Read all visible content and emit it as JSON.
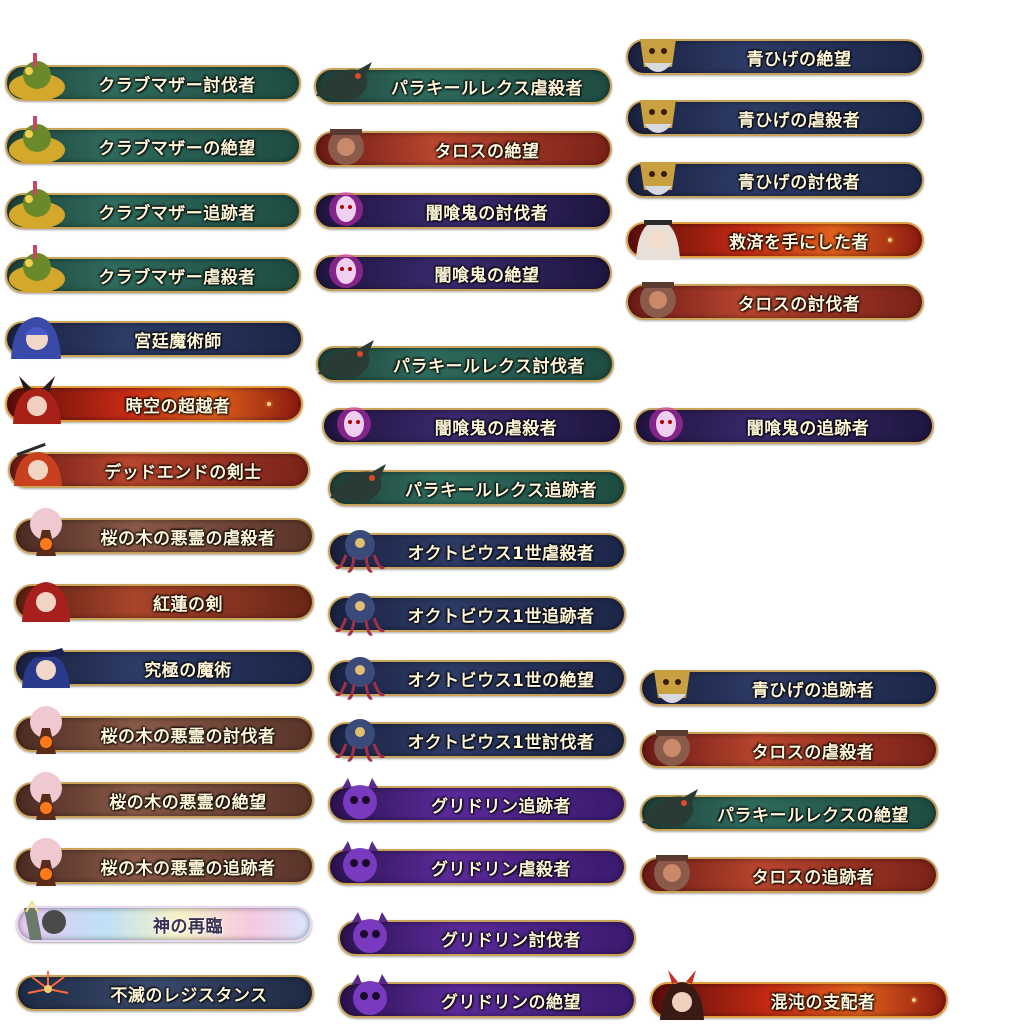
{
  "colors": {
    "gold_border": "#c9a35a",
    "label_text": "#fff6d8"
  },
  "badges": [
    {
      "label": "クラブマザー討伐者",
      "icon": "crab-monster-icon",
      "theme": "green"
    },
    {
      "label": "クラブマザーの絶望",
      "icon": "crab-monster-icon",
      "theme": "green"
    },
    {
      "label": "クラブマザー追跡者",
      "icon": "crab-monster-icon",
      "theme": "green"
    },
    {
      "label": "クラブマザー虐殺者",
      "icon": "crab-monster-icon",
      "theme": "green"
    },
    {
      "label": "宮廷魔術師",
      "icon": "blue-haired-mage-icon",
      "theme": "navy"
    },
    {
      "label": "時空の超越者",
      "icon": "horned-red-hair-portrait-icon",
      "theme": "fire"
    },
    {
      "label": "デッドエンドの剣士",
      "icon": "red-hair-swordsman-icon",
      "theme": "red"
    },
    {
      "label": "桜の木の悪霊の虐殺者",
      "icon": "cherry-tree-spirit-icon",
      "theme": "brown"
    },
    {
      "label": "紅蓮の剣",
      "icon": "crimson-hair-portrait-icon",
      "theme": "rust"
    },
    {
      "label": "究極の魔術",
      "icon": "blue-witch-icon",
      "theme": "navy"
    },
    {
      "label": "桜の木の悪霊の討伐者",
      "icon": "cherry-tree-spirit-icon",
      "theme": "brown"
    },
    {
      "label": "桜の木の悪霊の絶望",
      "icon": "cherry-tree-spirit-icon",
      "theme": "brown"
    },
    {
      "label": "桜の木の悪霊の追跡者",
      "icon": "cherry-tree-spirit-icon",
      "theme": "brown"
    },
    {
      "label": "神の再臨",
      "icon": "divine-crest-icon",
      "theme": "holo"
    },
    {
      "label": "不滅のレジスタンス",
      "icon": "firework-icon",
      "theme": "bluegray"
    },
    {
      "label": "パラキールレクス虐殺者",
      "icon": "dragon-icon",
      "theme": "green"
    },
    {
      "label": "タロスの絶望",
      "icon": "talos-golem-icon",
      "theme": "red"
    },
    {
      "label": "闇喰鬼の討伐者",
      "icon": "dark-demon-icon",
      "theme": "purple"
    },
    {
      "label": "闇喰鬼の絶望",
      "icon": "dark-demon-icon",
      "theme": "purple"
    },
    {
      "label": "パラキールレクス討伐者",
      "icon": "dragon-icon",
      "theme": "green"
    },
    {
      "label": "闇喰鬼の虐殺者",
      "icon": "dark-demon-icon",
      "theme": "purple"
    },
    {
      "label": "パラキールレクス追跡者",
      "icon": "dragon-icon",
      "theme": "green"
    },
    {
      "label": "オクトビウス1世虐殺者",
      "icon": "octopus-king-icon",
      "theme": "navy"
    },
    {
      "label": "オクトビウス1世追跡者",
      "icon": "octopus-king-icon",
      "theme": "navy"
    },
    {
      "label": "オクトビウス1世の絶望",
      "icon": "octopus-king-icon",
      "theme": "navy"
    },
    {
      "label": "オクトビウス1世討伐者",
      "icon": "octopus-king-icon",
      "theme": "navy"
    },
    {
      "label": "グリドリン追跡者",
      "icon": "purple-skull-beast-icon",
      "theme": "violet"
    },
    {
      "label": "グリドリン虐殺者",
      "icon": "purple-skull-beast-icon",
      "theme": "violet"
    },
    {
      "label": "グリドリン討伐者",
      "icon": "purple-skull-beast-icon",
      "theme": "violet"
    },
    {
      "label": "グリドリンの絶望",
      "icon": "purple-skull-beast-icon",
      "theme": "violet"
    },
    {
      "label": "青ひげの絶望",
      "icon": "bluebeard-mask-icon",
      "theme": "navy"
    },
    {
      "label": "青ひげの虐殺者",
      "icon": "bluebeard-mask-icon",
      "theme": "navy"
    },
    {
      "label": "青ひげの討伐者",
      "icon": "bluebeard-mask-icon",
      "theme": "navy"
    },
    {
      "label": "救済を手にした者",
      "icon": "white-hair-girl-icon",
      "theme": "fire"
    },
    {
      "label": "タロスの討伐者",
      "icon": "talos-golem-icon",
      "theme": "red"
    },
    {
      "label": "闇喰鬼の追跡者",
      "icon": "dark-demon-icon",
      "theme": "purple"
    },
    {
      "label": "青ひげの追跡者",
      "icon": "bluebeard-mask-icon",
      "theme": "navy"
    },
    {
      "label": "タロスの虐殺者",
      "icon": "talos-golem-icon",
      "theme": "red"
    },
    {
      "label": "パラキールレクスの絶望",
      "icon": "dragon-icon",
      "theme": "green"
    },
    {
      "label": "タロスの追跡者",
      "icon": "talos-golem-icon",
      "theme": "red"
    },
    {
      "label": "混沌の支配者",
      "icon": "horned-demon-girl-icon",
      "theme": "fire"
    }
  ]
}
